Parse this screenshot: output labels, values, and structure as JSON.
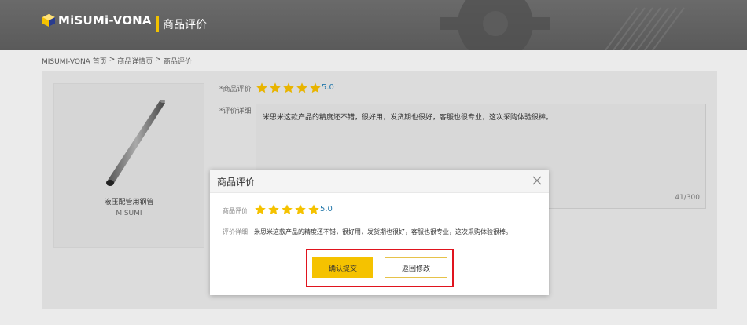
{
  "header": {
    "brand": "MiSUMi-VONA",
    "section_title": "商品评价"
  },
  "breadcrumb": {
    "items": [
      "MISUMI-VONA 首页",
      "商品详情页",
      "商品评价"
    ],
    "separator": ">"
  },
  "product": {
    "name": "液压配管用钢管",
    "brand": "MISUMI"
  },
  "review_form": {
    "rating_label": "*商品评价",
    "rating": 5.0,
    "rating_text": "5.0",
    "detail_label": "*评价详细",
    "detail_text": "米思米这款产品的精度还不错，很好用，发货期也很好，客服也很专业，这次采购体验很棒。",
    "char_count": "41/300"
  },
  "modal": {
    "title": "商品评价",
    "rating_label": "商品评价",
    "rating_text": "5.0",
    "detail_label": "评价详细",
    "detail_text": "米思米这款产品的精度还不错，很好用，发货期也很好，客服也很专业，这次采购体验很棒。",
    "confirm_label": "确认提交",
    "back_label": "返回修改"
  },
  "colors": {
    "accent": "#f5c200",
    "star": "#f5c200",
    "highlight_border": "#e0141e",
    "header_bg": "#5f5f5f"
  },
  "icons": {
    "close": "close-icon",
    "star": "star-icon",
    "logo": "misumi-logo-icon"
  }
}
